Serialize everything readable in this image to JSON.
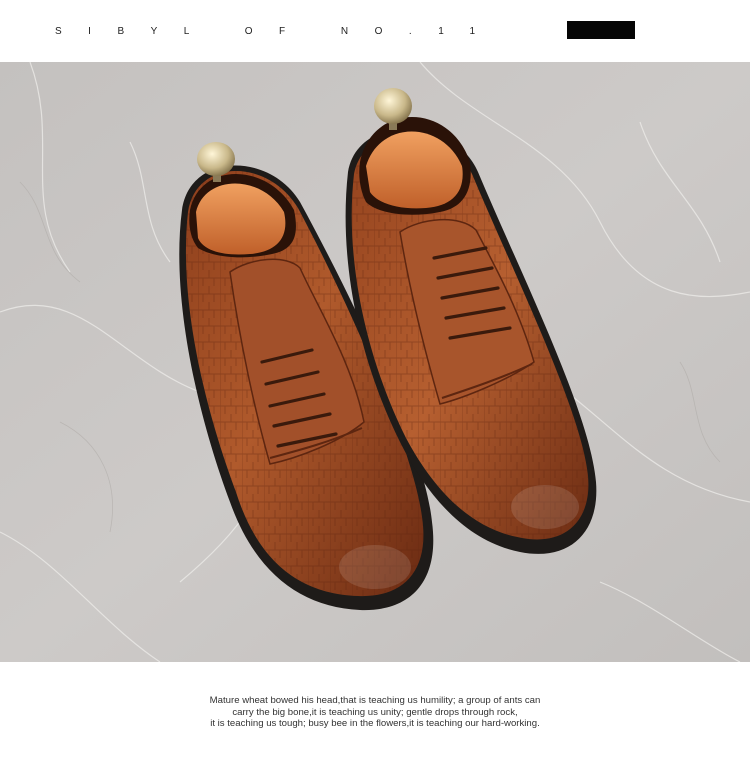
{
  "header": {
    "brand_text": "SIBYL OF NO.11"
  },
  "photo": {
    "subject": "brown-oxford-shoes-icon",
    "colors": {
      "marble": "#c8c5c3",
      "leather": "#9a4a22",
      "leather_dark": "#5e2610",
      "sole": "#1e1b19",
      "shoe_tree": "#e0843f"
    }
  },
  "caption": {
    "line1": "Mature wheat bowed his head,that is teaching us humility; a group of ants can",
    "line2": "carry the big bone,it is teaching us unity; gentle drops through rock,",
    "line3": "it is teaching us tough; busy bee in the flowers,it is teaching our hard-working."
  }
}
